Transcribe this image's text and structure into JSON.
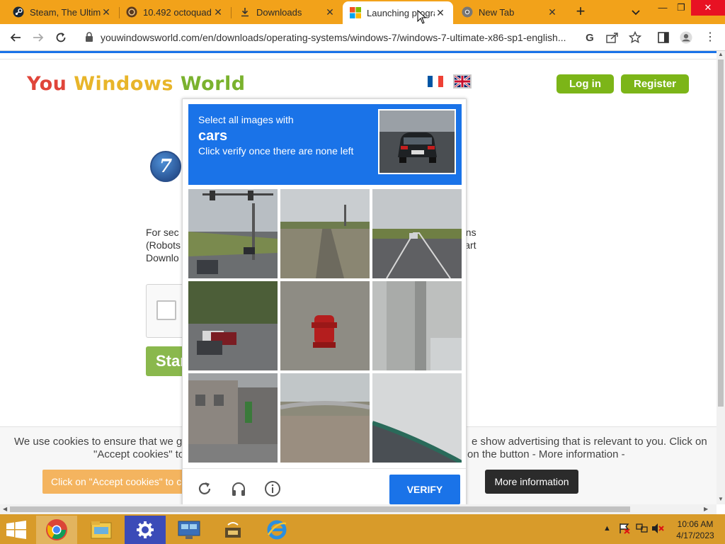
{
  "browser": {
    "tabs": [
      {
        "title": "Steam, The Ultimate",
        "icon": "steam-icon"
      },
      {
        "title": "10.492 octoquad",
        "icon": "octoquad-icon"
      },
      {
        "title": "Downloads",
        "icon": "download-icon"
      },
      {
        "title": "Launching program",
        "icon": "windows-icon",
        "active": true
      },
      {
        "title": "New Tab",
        "icon": "chrome-icon"
      }
    ],
    "url": "youwindowsworld.com/en/downloads/operating-systems/windows-7/windows-7-ultimate-x86-sp1-english..."
  },
  "site": {
    "logo": {
      "w1": "You",
      "w2": "Windows",
      "w3": "World"
    },
    "login_label": "Log in",
    "register_label": "Register",
    "body_left": "For sec\n(Robots\nDownlo",
    "body_right": "ons\nart",
    "start_label": "Star"
  },
  "captcha": {
    "instruction_line1": "Select all images with",
    "target": "cars",
    "instruction_line3": "Click verify once there are none left",
    "verify_label": "VERIFY"
  },
  "cookies": {
    "text_left_1": "We use cookies to ensure that we g",
    "text_right_1": "e show advertising that is relevant to you. Click on",
    "text_left_2": "\"Accept cookies\" to",
    "text_right_2": "on the button - More information -",
    "accept_label": "Click on \"Accept cookies\" to c",
    "more_label": "More information"
  },
  "taskbar": {
    "time": "10:06 AM",
    "date": "4/17/2023"
  },
  "colors": {
    "accent_tabbar": "#f2a21a",
    "taskbar": "#d89b2a",
    "captcha_blue": "#1a73e8",
    "site_green": "#7cb518"
  }
}
